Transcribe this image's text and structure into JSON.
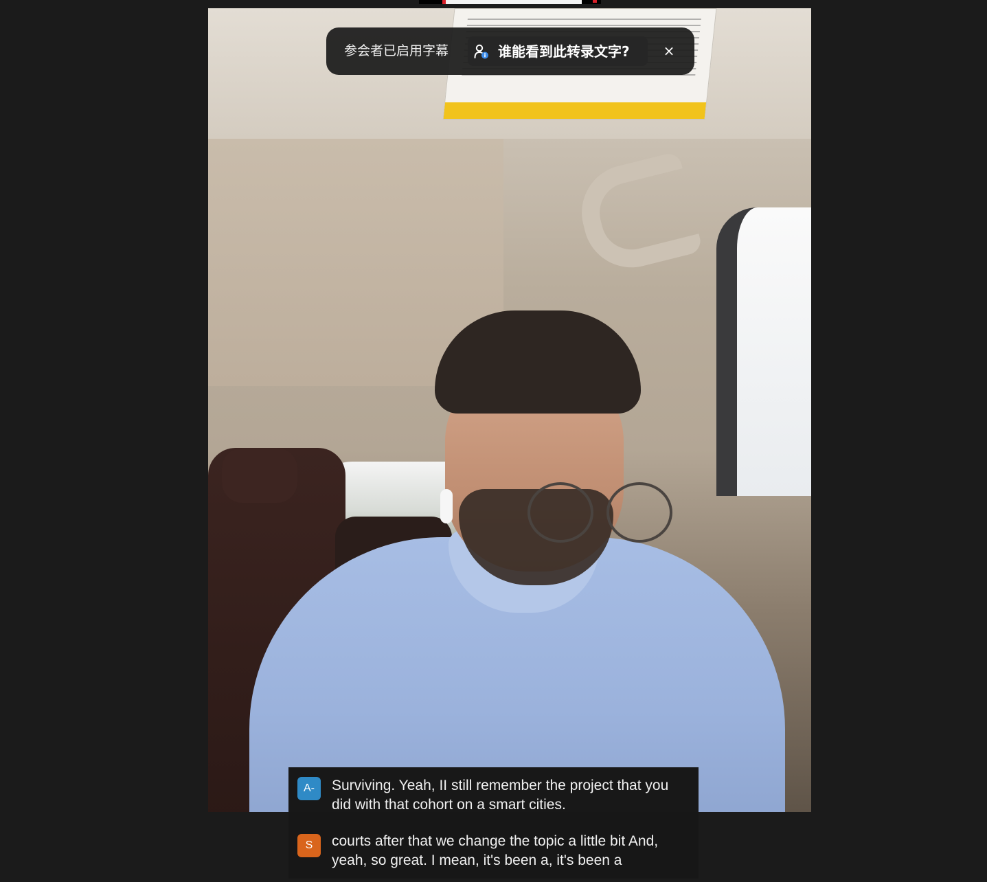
{
  "notice": {
    "text": "参会者已启用字幕",
    "who_button_label": "谁能看到此转录文字?",
    "close_label": "×"
  },
  "captions": [
    {
      "speaker_initial": "A-",
      "avatar_color": "#2f8ac6",
      "text": "Surviving. Yeah, II still remember the project that you did with that cohort on a smart cities."
    },
    {
      "speaker_initial": "S",
      "avatar_color": "#d9651c",
      "text": "courts after that we change the topic a little bit And, yeah, so great. I mean, it's been a, it's been a"
    }
  ],
  "colors": {
    "background": "#1b1b1b",
    "notice_bg": "#1e1e1e",
    "accent_blue": "#2f8ac6",
    "accent_orange": "#d9651c"
  },
  "icons": {
    "who_button": "person-with-info-icon",
    "close": "close-icon"
  }
}
